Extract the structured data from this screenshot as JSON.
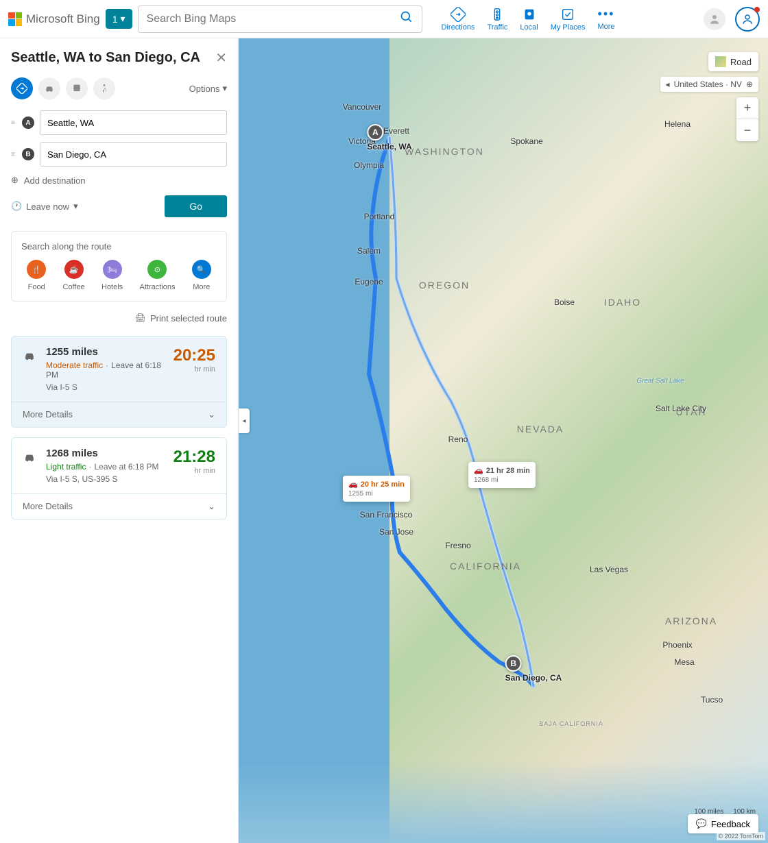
{
  "header": {
    "brand": "Microsoft Bing",
    "tab_number": "1",
    "search_placeholder": "Search Bing Maps",
    "nav": {
      "directions": "Directions",
      "traffic": "Traffic",
      "local": "Local",
      "my_places": "My Places",
      "more": "More"
    }
  },
  "directions": {
    "title": "Seattle, WA to San Diego, CA",
    "options_label": "Options",
    "waypoint_a": "Seattle, WA",
    "waypoint_b": "San Diego, CA",
    "add_destination": "Add destination",
    "leave_now": "Leave now",
    "go": "Go",
    "print": "Print selected route"
  },
  "search_route": {
    "title": "Search along the route",
    "food": "Food",
    "coffee": "Coffee",
    "hotels": "Hotels",
    "attractions": "Attractions",
    "more": "More"
  },
  "routes": [
    {
      "distance": "1255 miles",
      "traffic": "Moderate traffic",
      "traffic_class": "mod",
      "leave": "Leave at 6:18 PM",
      "via": "Via I-5 S",
      "time": "20:25",
      "unit": "hr  min",
      "more": "More Details"
    },
    {
      "distance": "1268 miles",
      "traffic": "Light traffic",
      "traffic_class": "light",
      "leave": "Leave at 6:18 PM",
      "via": "Via I-5 S, US-395 S",
      "time": "21:28",
      "unit": "hr  min",
      "more": "More Details"
    }
  ],
  "map": {
    "road_label": "Road",
    "location_pill": "United States · NV",
    "feedback": "Feedback",
    "scale_mi": "100 miles",
    "scale_km": "100 km",
    "copyright": "© 2022 TomTom",
    "marker_a": "A",
    "marker_a_label": "Seattle, WA",
    "marker_b": "B",
    "marker_b_label": "San Diego, CA",
    "tooltip1_time": "20 hr 25 min",
    "tooltip1_dist": "1255 mi",
    "tooltip2_time": "21 hr 28 min",
    "tooltip2_dist": "1268 mi",
    "cities": {
      "vancouver": "Vancouver",
      "victoria": "Victoria",
      "everett": "Everett",
      "spokane": "Spokane",
      "olympia": "Olympia",
      "portland": "Portland",
      "salem": "Salem",
      "eugene": "Eugene",
      "boise": "Boise",
      "helena": "Helena",
      "reno": "Reno",
      "saltlake": "Salt Lake City",
      "sanfran": "San Francisco",
      "sanjose": "San Jose",
      "fresno": "Fresno",
      "lasvegas": "Las Vegas",
      "phoenix": "Phoenix",
      "mesa": "Mesa",
      "tucson": "Tucso",
      "baja": "BAJA CALIFORNIA",
      "greatsalt": "Great Salt Lake"
    },
    "states": {
      "washington": "WASHINGTON",
      "oregon": "OREGON",
      "idaho": "IDAHO",
      "nevada": "NEVADA",
      "california": "CALIFORNIA",
      "utah": "UTAH",
      "arizona": "ARIZONA"
    }
  }
}
